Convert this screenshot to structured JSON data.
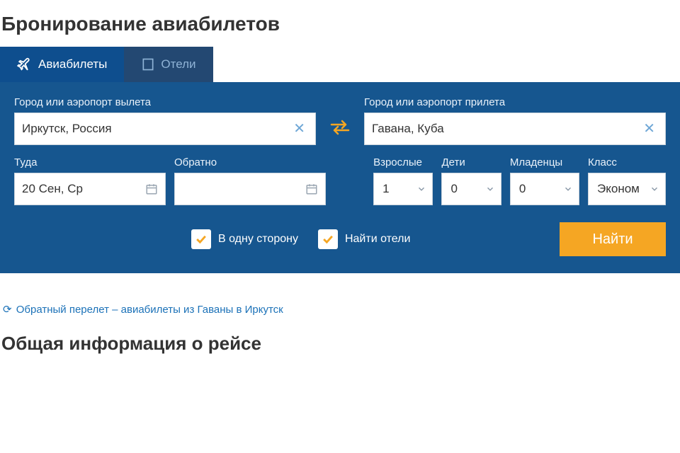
{
  "page": {
    "title": "Бронирование авиабилетов"
  },
  "tabs": {
    "flights": "Авиабилеты",
    "hotels": "Отели"
  },
  "form": {
    "from_label": "Город или аэропорт вылета",
    "from_value": "Иркутск, Россия",
    "to_label": "Город или аэропорт прилета",
    "to_value": "Гавана, Куба",
    "depart_label": "Туда",
    "depart_value": "20 Сен, Ср",
    "return_label": "Обратно",
    "return_value": "",
    "adults_label": "Взрослые",
    "adults_value": "1",
    "children_label": "Дети",
    "children_value": "0",
    "infants_label": "Младенцы",
    "infants_value": "0",
    "class_label": "Класс",
    "class_value": "Эконом",
    "one_way_label": "В одну сторону",
    "one_way_checked": true,
    "find_hotels_label": "Найти отели",
    "find_hotels_checked": true,
    "search_button": "Найти"
  },
  "links": {
    "return_flight": "Обратный перелет – авиабилеты из Гаваны в Иркутск"
  },
  "sections": {
    "flight_info_title": "Общая информация о рейсе"
  }
}
